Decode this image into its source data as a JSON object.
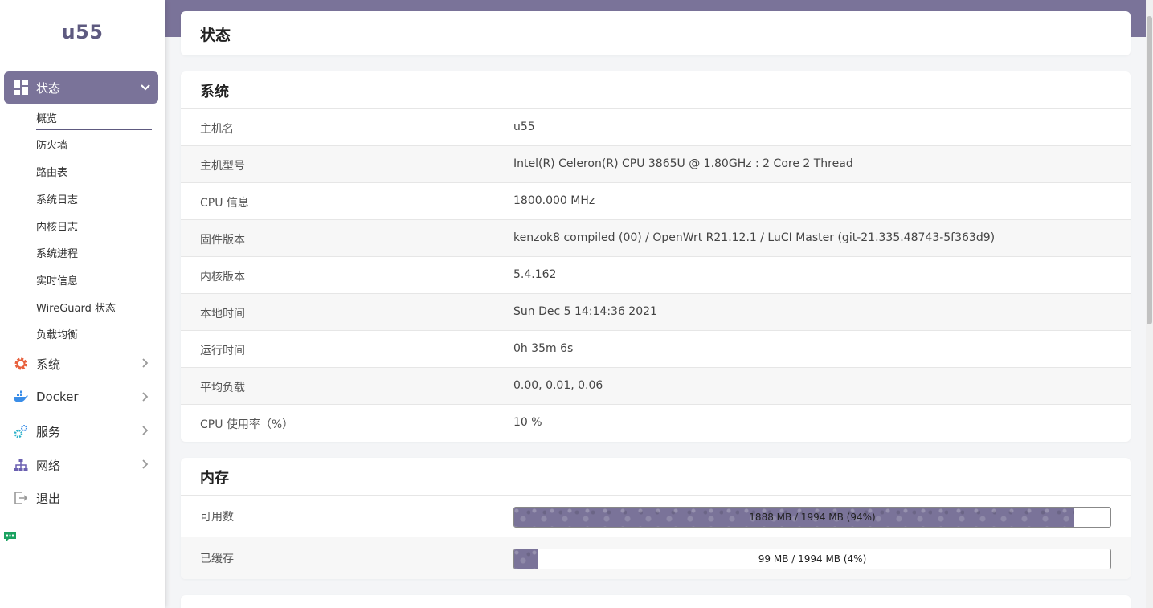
{
  "app": {
    "logo": "u55"
  },
  "sidebar": {
    "active": {
      "label": "状态",
      "icon": "dashboard-icon"
    },
    "subitems": [
      "概览",
      "防火墙",
      "路由表",
      "系统日志",
      "内核日志",
      "系统进程",
      "实时信息",
      "WireGuard 状态",
      "负载均衡"
    ],
    "items": [
      {
        "label": "系统",
        "icon": "gear-icon",
        "color": "#e8603c"
      },
      {
        "label": "Docker",
        "icon": "docker-icon",
        "color": "#3b8ee8"
      },
      {
        "label": "服务",
        "icon": "services-icon",
        "color": "#2bb0c8"
      },
      {
        "label": "网络",
        "icon": "network-icon",
        "color": "#6a5fb0"
      },
      {
        "label": "退出",
        "icon": "logout-icon",
        "color": "#999999"
      }
    ]
  },
  "page": {
    "title": "状态"
  },
  "system": {
    "title": "系统",
    "rows": [
      {
        "key": "主机名",
        "value": "u55"
      },
      {
        "key": "主机型号",
        "value": "Intel(R) Celeron(R) CPU 3865U @ 1.80GHz : 2 Core 2 Thread"
      },
      {
        "key": "CPU 信息",
        "value": "1800.000 MHz"
      },
      {
        "key": "固件版本",
        "value": "kenzok8 compiled (00) / OpenWrt R21.12.1 / LuCI Master (git-21.335.48743-5f363d9)"
      },
      {
        "key": "内核版本",
        "value": "5.4.162"
      },
      {
        "key": "本地时间",
        "value": "Sun Dec 5 14:14:36 2021"
      },
      {
        "key": "运行时间",
        "value": "0h 35m 6s"
      },
      {
        "key": "平均负载",
        "value": "0.00, 0.01, 0.06"
      },
      {
        "key": "CPU 使用率（%）",
        "value": "10 %"
      }
    ]
  },
  "memory": {
    "title": "内存",
    "rows": [
      {
        "key": "可用数",
        "text": "1888 MB / 1994 MB (94%)",
        "fraction": 0.94
      },
      {
        "key": "已缓存",
        "text": "99 MB / 1994 MB (4%)",
        "fraction": 0.04
      }
    ]
  },
  "colors": {
    "accent": "#7a7399",
    "brand": "#5e5a80"
  }
}
